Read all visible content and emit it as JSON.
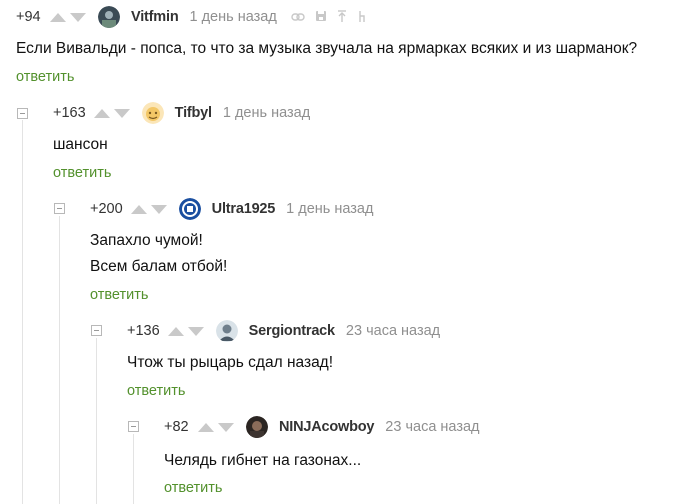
{
  "comments": [
    {
      "rating": "+94",
      "username": "Vitfmin",
      "time": "1 день назад",
      "avatar_icon": "avatar-photo-icon",
      "lines": [
        "Если Вивальди - попса, то что за музыка звучала на ярмарках всяких и из шарманок?"
      ],
      "reply_label": "ответить",
      "tools": [
        "link-icon",
        "save-icon",
        "go-to-parent-icon",
        "branch-icon"
      ]
    },
    {
      "rating": "+163",
      "username": "Tifbyl",
      "time": "1 день назад",
      "avatar_icon": "avatar-cartoon-icon",
      "lines": [
        "шансон"
      ],
      "reply_label": "ответить"
    },
    {
      "rating": "+200",
      "username": "Ultra1925",
      "time": "1 день назад",
      "avatar_icon": "avatar-dynamo-logo-icon",
      "lines": [
        "Запахло чумой!",
        "Всем балам отбой!"
      ],
      "reply_label": "ответить"
    },
    {
      "rating": "+136",
      "username": "Sergiontrack",
      "time": "23 часа назад",
      "avatar_icon": "avatar-photo-icon",
      "lines": [
        "Чтож ты рыцарь сдал назад!"
      ],
      "reply_label": "ответить"
    },
    {
      "rating": "+82",
      "username": "NINJAcowboy",
      "time": "23 часа назад",
      "avatar_icon": "avatar-photo-icon",
      "lines": [
        "Челядь гибнет на газонах..."
      ],
      "reply_label": "ответить"
    }
  ],
  "colors": {
    "reply_link": "#53912d",
    "muted_text": "#8f8f8f",
    "vote_arrows": "#c9c9c9",
    "thread_line": "#e3e3e3"
  }
}
